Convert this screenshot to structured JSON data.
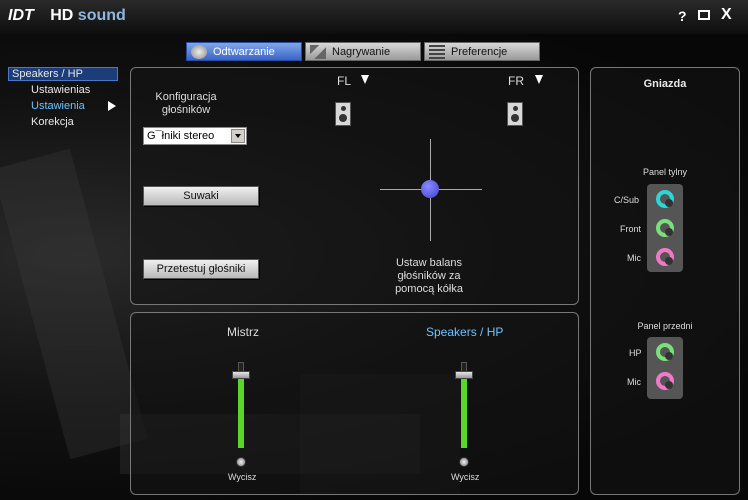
{
  "app": {
    "brand": "IDT",
    "title_a": "HD",
    "title_b": "sound"
  },
  "window_controls": {
    "help": "?",
    "close": "X"
  },
  "tabs": [
    {
      "label": "Odtwarzanie",
      "icon": "speaker-icon",
      "active": true
    },
    {
      "label": "Nagrywanie",
      "icon": "microphone-icon",
      "active": false
    },
    {
      "label": "Preferencje",
      "icon": "list-icon",
      "active": false
    }
  ],
  "sidebar": {
    "device": "Speakers / HP",
    "items": [
      "Ustawienias",
      "Ustawienia",
      "Korekcja"
    ]
  },
  "config": {
    "title": "Konfiguracja głośników",
    "select_value": "G¯łniki stereo",
    "sliders_button": "Suwaki",
    "test_button": "Przetestuj głośniki"
  },
  "balance": {
    "fl": "FL",
    "fr": "FR",
    "instruction": "Ustaw balans głośników za pomocą kółka"
  },
  "mixer": {
    "master": {
      "label": "Mistrz",
      "mute_label": "Wycisz",
      "level": 0.85
    },
    "device": {
      "label": "Speakers / HP",
      "mute_label": "Wycisz",
      "level": 0.85
    }
  },
  "jacks": {
    "title": "Gniazda",
    "rear": {
      "title": "Panel tylny",
      "items": [
        {
          "label": "C/Sub",
          "color": "#2fd6d6"
        },
        {
          "label": "Front",
          "color": "#7ae07a"
        },
        {
          "label": "Mic",
          "color": "#f07ac8"
        }
      ]
    },
    "front": {
      "title": "Panel przedni",
      "items": [
        {
          "label": "HP",
          "color": "#7ae07a"
        },
        {
          "label": "Mic",
          "color": "#f07ac8"
        }
      ]
    }
  },
  "colors": {
    "accent": "#6fc3ff",
    "slider_fill": "#5ad62a",
    "balance_dot": "#5050e0"
  }
}
